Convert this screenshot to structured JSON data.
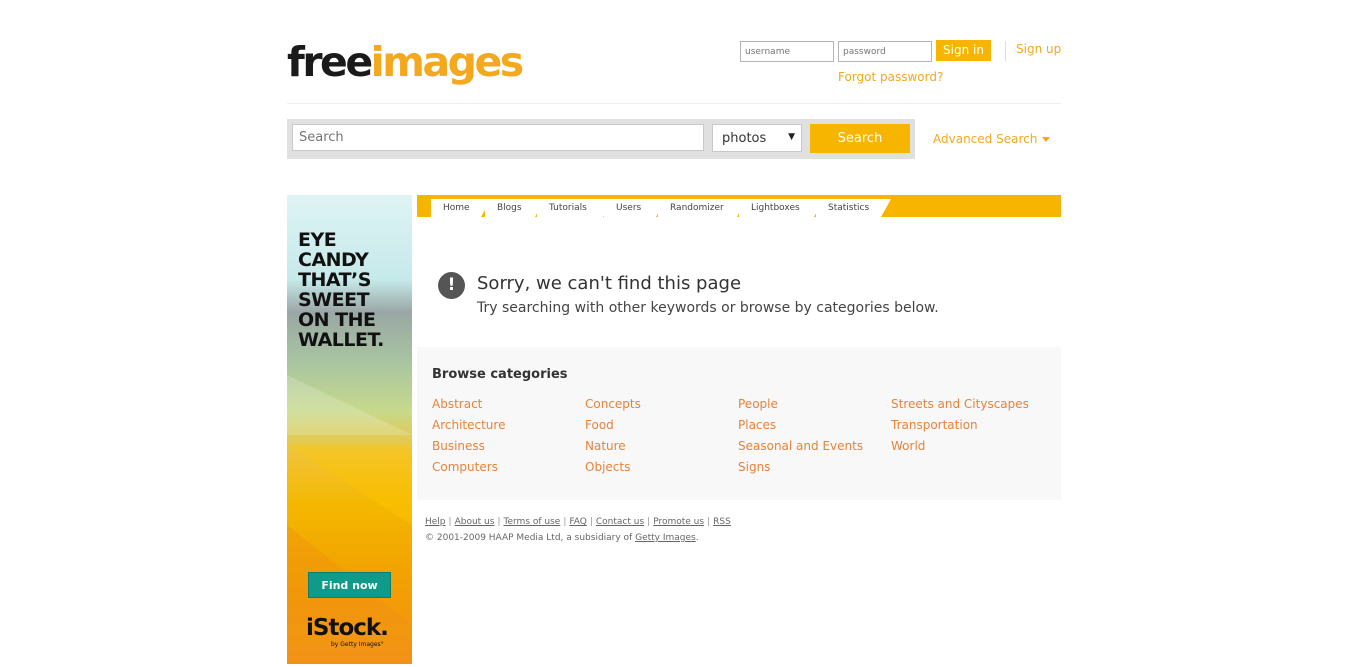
{
  "logo": {
    "part1": "free",
    "part2": "images"
  },
  "login": {
    "username_placeholder": "username",
    "password_placeholder": "password",
    "signin_label": "Sign in",
    "signup_label": "Sign up",
    "forgot_label": "Forgot password?"
  },
  "search": {
    "placeholder": "Search",
    "type_selected": "photos",
    "button_label": "Search",
    "advanced_label": "Advanced Search"
  },
  "ad": {
    "headline": [
      "EYE",
      "CANDY",
      "THAT’S",
      "SWEET",
      "ON THE",
      "WALLET."
    ],
    "button_label": "Find now",
    "brand": "iStock.",
    "brand_sub": "by Getty Images°"
  },
  "nav": {
    "tabs": [
      "Home",
      "Blogs",
      "Tutorials",
      "Users",
      "Randomizer",
      "Lightboxes",
      "Statistics"
    ]
  },
  "error": {
    "icon": "!",
    "title": "Sorry, we can't find this page",
    "subtitle": "Try searching with other keywords or browse by categories below."
  },
  "categories": {
    "heading": "Browse categories",
    "columns": [
      [
        "Abstract",
        "Architecture",
        "Business",
        "Computers"
      ],
      [
        "Concepts",
        "Food",
        "Nature",
        "Objects"
      ],
      [
        "People",
        "Places",
        "Seasonal and Events",
        "Signs"
      ],
      [
        "Streets and Cityscapes",
        "Transportation",
        "World"
      ]
    ]
  },
  "footer": {
    "links": [
      "Help",
      "About us",
      "Terms of use",
      "FAQ",
      "Contact us",
      "Promote us",
      "RSS"
    ],
    "copyright_prefix": "© 2001-2009 HAAP Media Ltd, a subsidiary of ",
    "copyright_link": "Getty Images",
    "copyright_suffix": "."
  },
  "colors": {
    "accent": "#f7b500",
    "link": "#e8823a",
    "brand_orange": "#f3a81d"
  }
}
